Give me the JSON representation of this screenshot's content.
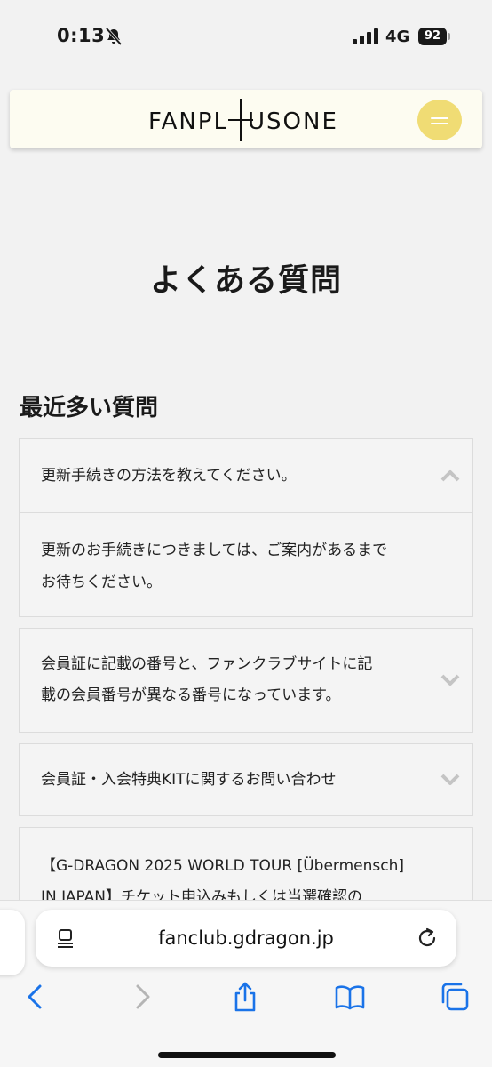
{
  "status": {
    "time": "0:13",
    "network": "4G",
    "battery": "92",
    "icons": [
      "bell-slash-icon",
      "signal-icon"
    ]
  },
  "header": {
    "logo_text": "FANPLUSONE",
    "menu_icon": "menu-icon",
    "menu_color": "#f0dc74"
  },
  "page": {
    "title": "よくある質問",
    "section_title": "最近多い質問"
  },
  "faq": [
    {
      "question": "更新手続きの方法を教えてください。",
      "answer_lines": [
        "更新のお手続きにつきましては、ご案内があるまで",
        "お待ちください。"
      ],
      "expanded": true
    },
    {
      "question_lines": [
        "会員証に記載の番号と、ファンクラブサイトに記",
        "載の会員番号が異なる番号になっています。"
      ],
      "expanded": false
    },
    {
      "question": "会員証・入会特典KITに関するお問い合わせ",
      "expanded": false
    },
    {
      "question_lines": [
        "【G-DRAGON 2025 WORLD TOUR [Übermensch]",
        "IN JAPAN】チケット申込みもしくは当選確認の"
      ],
      "expanded": false
    }
  ],
  "browser": {
    "url": "fanclub.gdragon.jp",
    "accent": "#1a73e8",
    "toolbar": [
      "back-icon",
      "forward-icon",
      "share-icon",
      "bookmarks-icon",
      "tabs-icon"
    ]
  }
}
